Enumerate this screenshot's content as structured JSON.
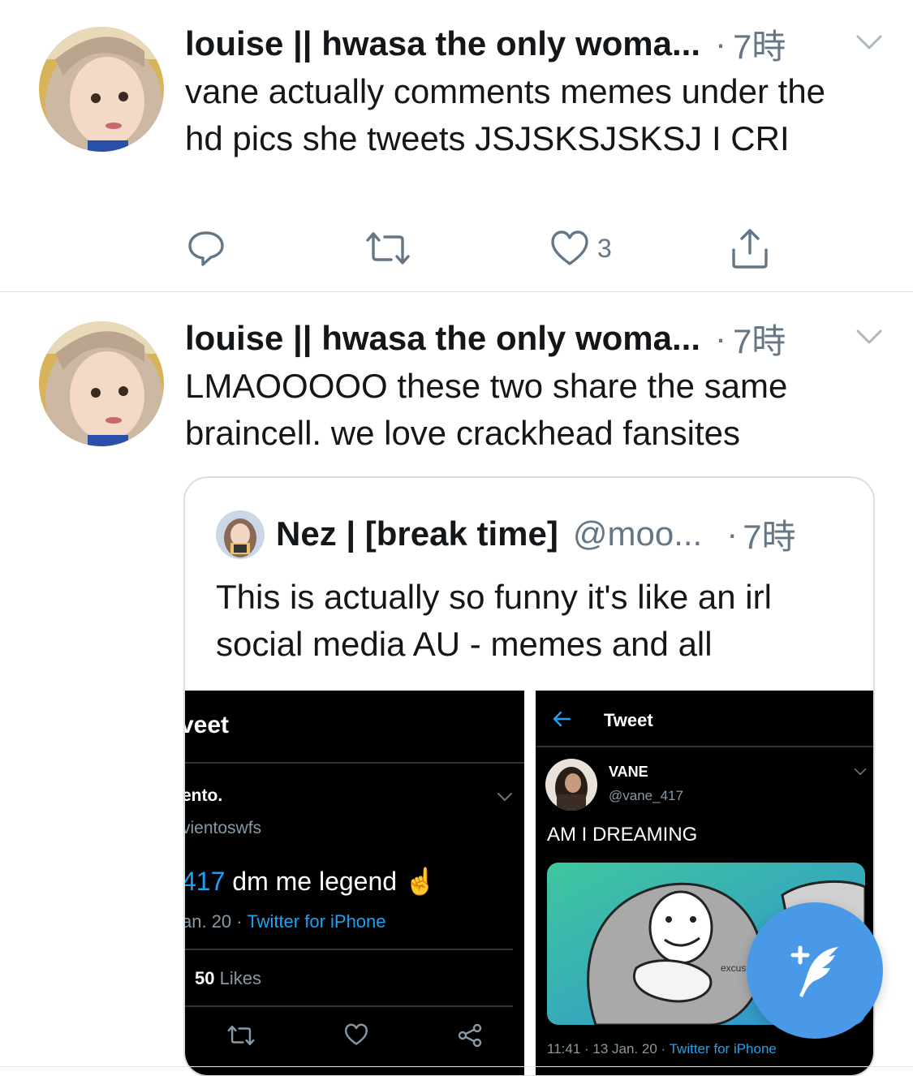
{
  "tweets": [
    {
      "display_name": "louise || hwasa the only woma...",
      "time": "7時",
      "text": "vane actually comments memes under the hd pics she tweets JSJSKSJSKSJ I CRI",
      "likes": "3"
    },
    {
      "display_name": "louise || hwasa the only woma...",
      "time": "7時",
      "text": "LMAOOOOO these two share the same braincell. we love crackhead fansites",
      "quote": {
        "display_name": "Nez | [break time]",
        "handle": "@moo...",
        "time": "7時",
        "text": "This is actually so funny it's like an irl social media AU - memes and all",
        "left_panel": {
          "title": "veet",
          "name": "ento.",
          "handle": "vientoswfs",
          "mention": "417",
          "body": " dm me legend ☝️",
          "meta_date": "an. 20 · ",
          "source": "Twitter for iPhone",
          "likes_count": "50",
          "likes_label": " Likes"
        },
        "right_panel": {
          "title": "Tweet",
          "name": "VANE",
          "handle": "@vane_417",
          "text": "AM I DREAMING",
          "image_caption": "excus",
          "meta_date": "11:41 · 13 Jan. 20 · ",
          "source": "Twitter for iPhone"
        }
      }
    }
  ],
  "colors": {
    "accent": "#1da1f2",
    "fab": "#4a99e9",
    "secondary_text": "#657786",
    "divider": "#d8dde1"
  },
  "icons": {
    "reply": "reply-icon",
    "retweet": "retweet-icon",
    "like": "heart-icon",
    "share": "share-icon",
    "menu": "chevron-down-icon",
    "compose": "compose-tweet-icon"
  }
}
